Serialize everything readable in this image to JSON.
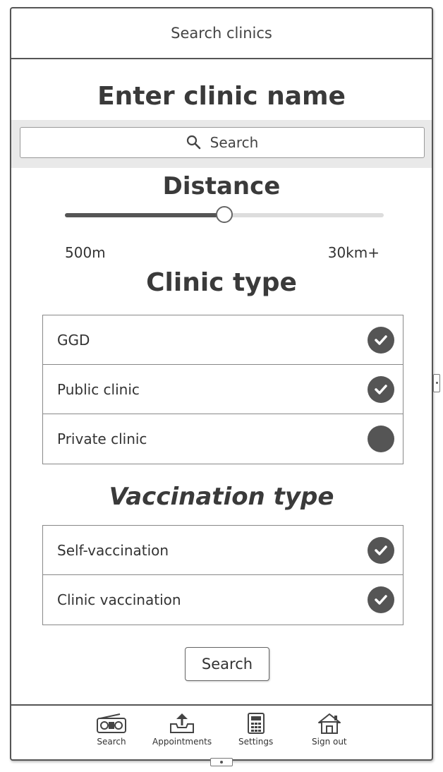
{
  "header": {
    "title": "Search clinics"
  },
  "name_section": {
    "heading": "Enter clinic name",
    "search_placeholder": "Search"
  },
  "distance": {
    "heading": "Distance",
    "min_label": "500m",
    "max_label": "30km+",
    "slider_fraction": 0.5
  },
  "clinic_type": {
    "heading": "Clinic type",
    "options": [
      {
        "label": "GGD",
        "checked": true
      },
      {
        "label": "Public clinic",
        "checked": true
      },
      {
        "label": "Private clinic",
        "checked": false
      }
    ]
  },
  "vaccination_type": {
    "heading": "Vaccination type",
    "options": [
      {
        "label": "Self-vaccination",
        "checked": true
      },
      {
        "label": "Clinic vaccination",
        "checked": true
      }
    ]
  },
  "search_button": {
    "label": "Search"
  },
  "bottom_nav": {
    "items": [
      {
        "label": "Search",
        "icon": "radio-icon"
      },
      {
        "label": "Appointments",
        "icon": "inbox-upload-icon"
      },
      {
        "label": "Settings",
        "icon": "calculator-icon"
      },
      {
        "label": "Sign out",
        "icon": "home-icon"
      }
    ]
  },
  "colors": {
    "ink": "#555555",
    "band": "#e9e9e9",
    "track": "#dddddd"
  }
}
